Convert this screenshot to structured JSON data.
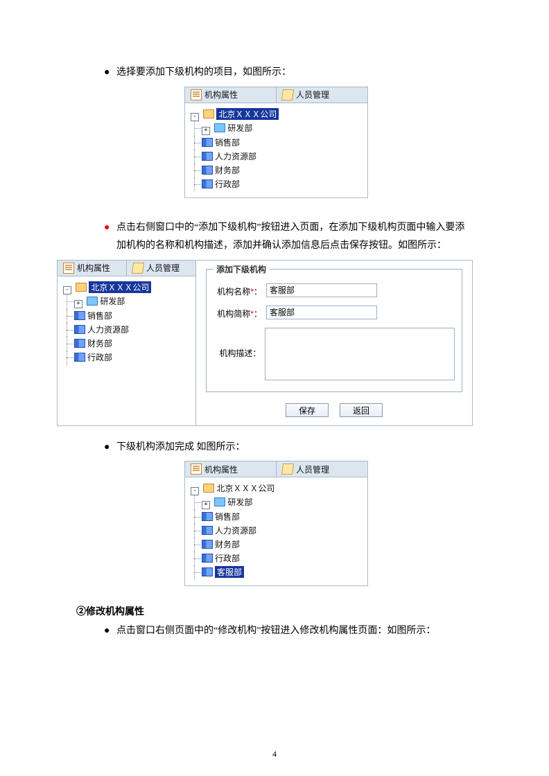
{
  "bullets": {
    "b1": "选择要添加下级机构的项目，如图所示：",
    "b2": "点击右侧窗口中的“添加下级机构”按钮进入页面，在添加下级机构页面中输入要添加机构的名称和机构描述，添加并确认添加信息后点击保存按钮。如图所示：",
    "b3": "下级机构添加完成 如图所示：",
    "b4": "点击窗口右侧页面中的“修改机构”按钮进入修改机构属性页面：如图所示："
  },
  "section2": "②修改机构属性",
  "toolbar": {
    "props": "机构属性",
    "staff": "人员管理"
  },
  "tree_root": "北京ＸＸＸ公司",
  "tree_children": [
    "研发部",
    "销售部",
    "人力资源部",
    "财务部",
    "行政部"
  ],
  "tree_new": "客服部",
  "twisty_minus": "-",
  "twisty_plus": "+",
  "form": {
    "title": "添加下级机构",
    "name_lab": "机构名称",
    "abbr_lab": "机构简称",
    "desc_lab": "机构描述：",
    "name_val": "客服部",
    "abbr_val": "客服部",
    "save": "保存",
    "back": "返回"
  },
  "pagenum": "4"
}
